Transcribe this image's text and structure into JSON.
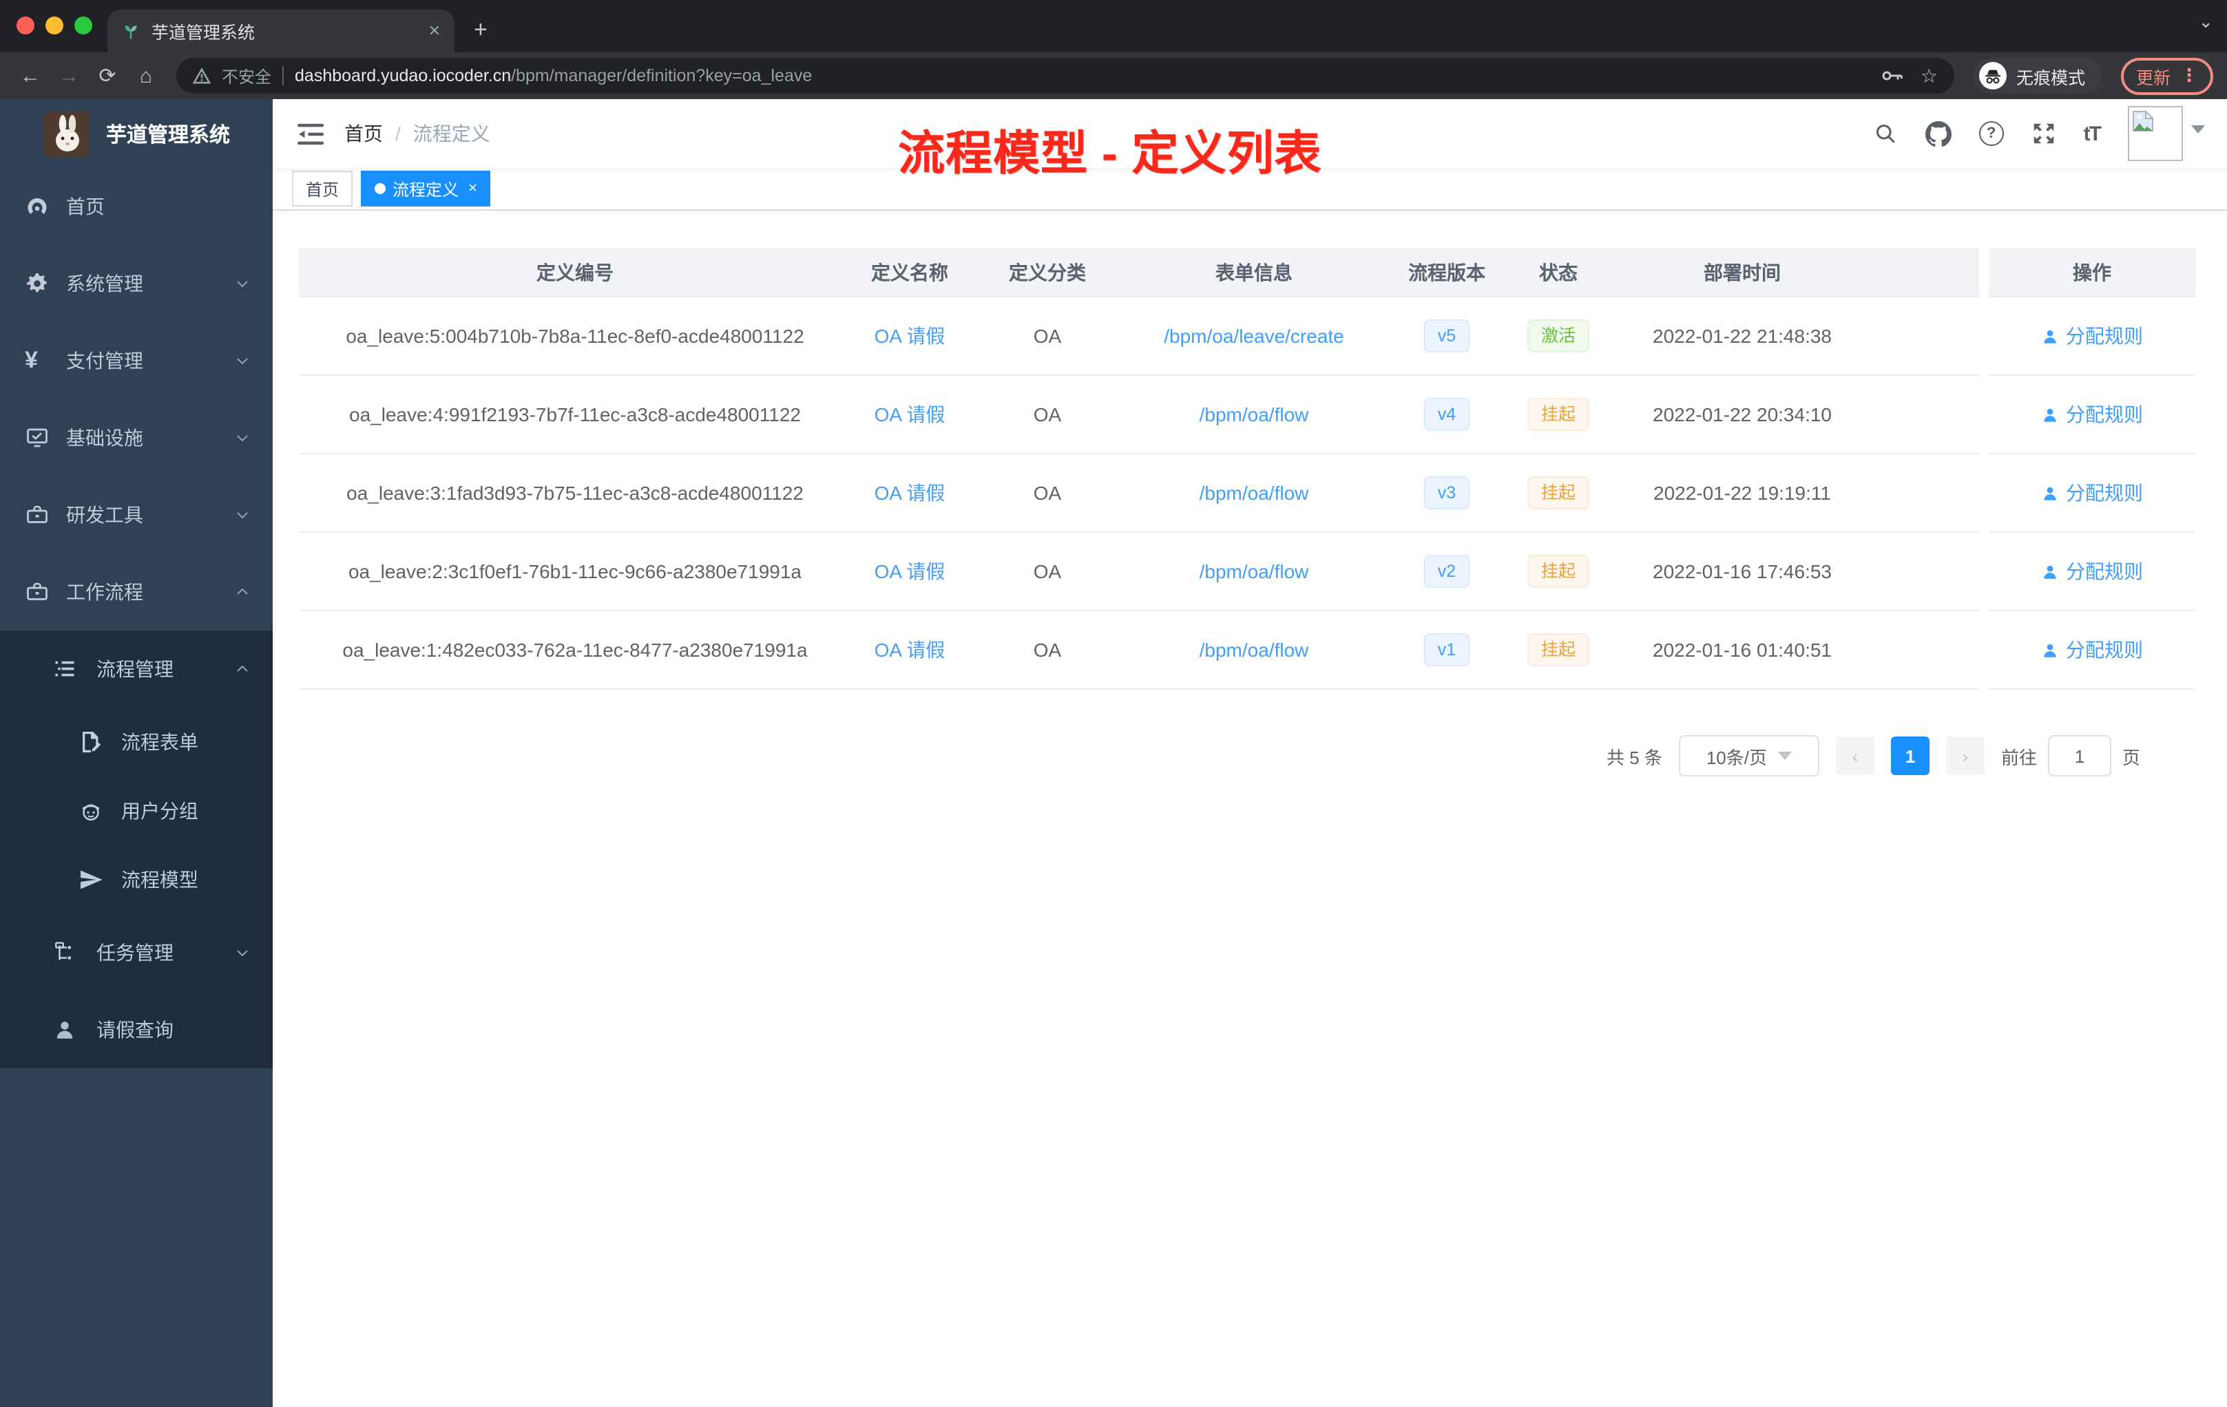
{
  "colors": {
    "accent": "#1890ff",
    "link": "#409eff",
    "success_text": "#67c23a",
    "warning_text": "#e6a23c",
    "annotation_red": "#f8281a",
    "sidebar_bg": "#304156",
    "sidebar_submenu_bg": "#1f2d3d"
  },
  "glyphs": {
    "close": "✕",
    "plus": "+",
    "back": "←",
    "forward": "→",
    "reload": "⟳",
    "home": "⌂",
    "star": "☆",
    "dots": "⋮",
    "question": "?",
    "tt": "tT",
    "prev": "‹",
    "next": "›",
    "tab_search": "⌄",
    "tag_close": "×"
  },
  "browser": {
    "tab_title": "芋道管理系统",
    "not_secure": "不安全",
    "url_host": "dashboard.yudao.iocoder.cn",
    "url_path": "/bpm/manager/definition?key=oa_leave",
    "incognito": "无痕模式",
    "update": "更新"
  },
  "sidebar": {
    "brand": "芋道管理系统",
    "items": [
      {
        "label": "首页",
        "icon": "dashboard-icon"
      },
      {
        "label": "系统管理",
        "icon": "gear-icon",
        "chevron": "down"
      },
      {
        "label": "支付管理",
        "icon": "yen-icon",
        "chevron": "down"
      },
      {
        "label": "基础设施",
        "icon": "monitor-icon",
        "chevron": "down"
      },
      {
        "label": "研发工具",
        "icon": "toolbox-icon",
        "chevron": "down"
      },
      {
        "label": "工作流程",
        "icon": "briefcase-icon",
        "chevron": "up"
      }
    ],
    "sub": [
      {
        "label": "流程管理",
        "icon": "list-icon",
        "chevron": "up",
        "children": [
          {
            "label": "流程表单",
            "icon": "form-icon"
          },
          {
            "label": "用户分组",
            "icon": "robot-icon"
          },
          {
            "label": "流程模型",
            "icon": "send-icon"
          }
        ]
      },
      {
        "label": "任务管理",
        "icon": "tree-icon",
        "chevron": "down",
        "children": []
      },
      {
        "label": "请假查询",
        "icon": "user-icon",
        "children": []
      }
    ]
  },
  "navbar": {
    "breadcrumb_home": "首页",
    "breadcrumb_sep": "/",
    "breadcrumb_current": "流程定义",
    "annotation": "流程模型 - 定义列表"
  },
  "tags": {
    "home": "首页",
    "active": "流程定义"
  },
  "table": {
    "headers": [
      "定义编号",
      "定义名称",
      "定义分类",
      "表单信息",
      "流程版本",
      "状态",
      "部署时间",
      "操作"
    ],
    "action": "分配规则",
    "rows": [
      {
        "id": "oa_leave:5:004b710b-7b8a-11ec-8ef0-acde48001122",
        "name": "OA 请假",
        "category": "OA",
        "form": "/bpm/oa/leave/create",
        "version": "v5",
        "status": "激活",
        "time": "2022-01-22 21:48:38"
      },
      {
        "id": "oa_leave:4:991f2193-7b7f-11ec-a3c8-acde48001122",
        "name": "OA 请假",
        "category": "OA",
        "form": "/bpm/oa/flow",
        "version": "v4",
        "status": "挂起",
        "time": "2022-01-22 20:34:10"
      },
      {
        "id": "oa_leave:3:1fad3d93-7b75-11ec-a3c8-acde48001122",
        "name": "OA 请假",
        "category": "OA",
        "form": "/bpm/oa/flow",
        "version": "v3",
        "status": "挂起",
        "time": "2022-01-22 19:19:11"
      },
      {
        "id": "oa_leave:2:3c1f0ef1-76b1-11ec-9c66-a2380e71991a",
        "name": "OA 请假",
        "category": "OA",
        "form": "/bpm/oa/flow",
        "version": "v2",
        "status": "挂起",
        "time": "2022-01-16 17:46:53"
      },
      {
        "id": "oa_leave:1:482ec033-762a-11ec-8477-a2380e71991a",
        "name": "OA 请假",
        "category": "OA",
        "form": "/bpm/oa/flow",
        "version": "v1",
        "status": "挂起",
        "time": "2022-01-16 01:40:51"
      }
    ]
  },
  "pagination": {
    "total": "共 5 条",
    "size": "10条/页",
    "page": "1",
    "goto": "前往",
    "goto_value": "1",
    "unit": "页"
  }
}
